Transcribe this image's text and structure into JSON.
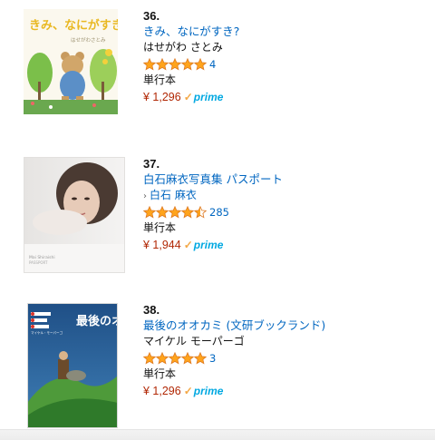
{
  "items": [
    {
      "rank": "36.",
      "title": "きみ、なにがすき?",
      "author": "はせがわ さとみ",
      "author_is_link": false,
      "rating": 5.0,
      "review_count": "4",
      "format": "単行本",
      "price": "¥ 1,296",
      "prime_label": "prime",
      "cover": {
        "title_text": "きみ、なにがすき?",
        "author_text": "はせがわさとみ"
      }
    },
    {
      "rank": "37.",
      "title": "白石麻衣写真集 パスポート",
      "author": "白石 麻衣",
      "author_is_link": true,
      "rating": 4.5,
      "review_count": "285",
      "format": "単行本",
      "price": "¥ 1,944",
      "prime_label": "prime",
      "cover": {
        "title_text": "Mai Shiraishi",
        "author_text": "PASSPORT"
      }
    },
    {
      "rank": "38.",
      "title": "最後のオオカミ (文研ブックランド)",
      "author": "マイケル モーパーゴ",
      "author_is_link": false,
      "rating": 5.0,
      "review_count": "3",
      "format": "単行本",
      "price": "¥ 1,296",
      "prime_label": "prime",
      "cover": {
        "title_text": "最後のオオカミ",
        "author_text": "マイケル・モーパーゴ"
      }
    }
  ],
  "colors": {
    "link": "#0066c0",
    "price": "#b12704",
    "star": "#ffa41c",
    "prime": "#00a8e1",
    "prime_check": "#f3a847"
  }
}
